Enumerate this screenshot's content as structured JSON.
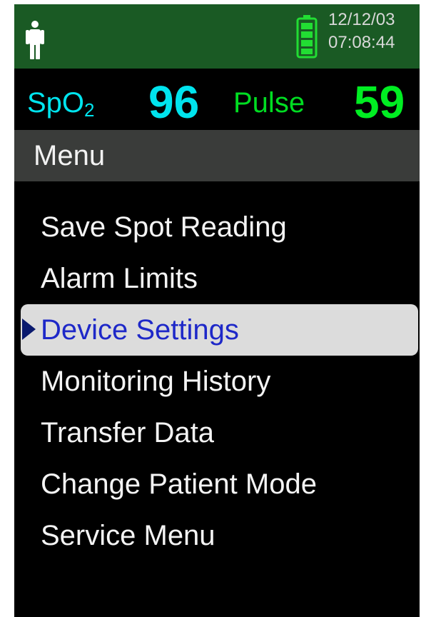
{
  "device": {
    "date": "12/12/03",
    "time": "07:08:44",
    "person_icon": "person-icon",
    "battery_icon": "battery-full-icon",
    "colors": {
      "header_bg": "#1a5a24",
      "spo2": "#00e4ee",
      "pulse": "#00ee22",
      "selected_bg": "#dcdcdc",
      "selected_text": "#1e28c8"
    }
  },
  "vitals": {
    "spo2_label": "SpO",
    "spo2_subscript": "2",
    "spo2_value": "96",
    "pulse_label": "Pulse",
    "pulse_value": "59"
  },
  "menu": {
    "title": "Menu",
    "items": [
      {
        "label": "Save Spot Reading"
      },
      {
        "label": "Alarm Limits"
      },
      {
        "label": "Device Settings",
        "selected": true
      },
      {
        "label": "Monitoring History"
      },
      {
        "label": "Transfer Data"
      },
      {
        "label": "Change Patient Mode"
      },
      {
        "label": "Service Menu"
      }
    ]
  }
}
